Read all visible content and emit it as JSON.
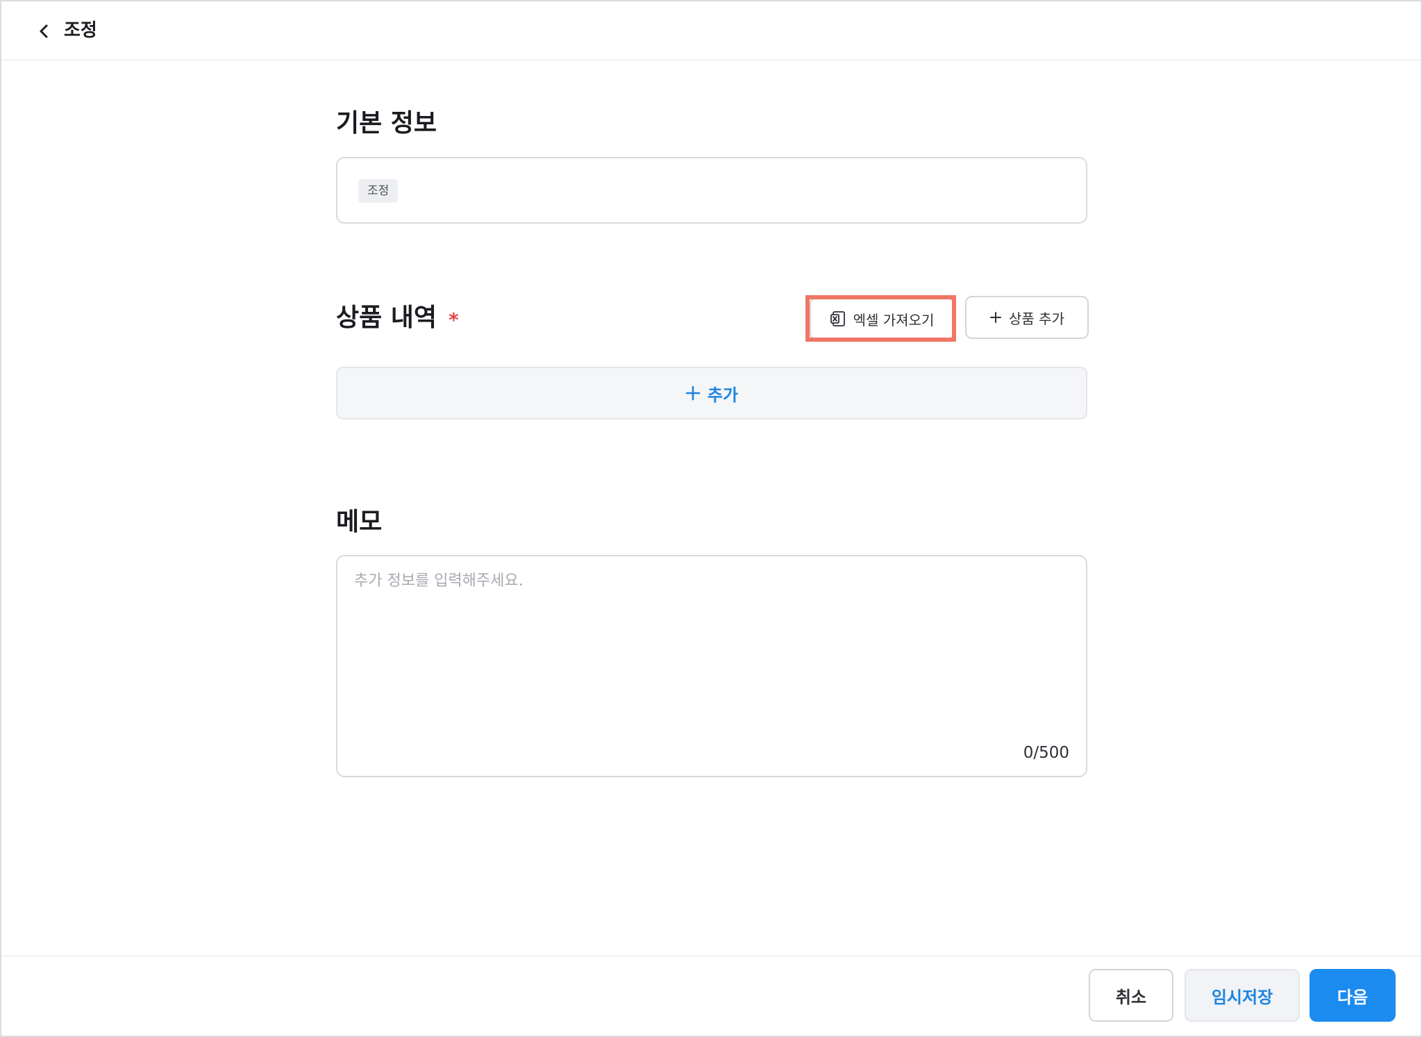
{
  "header": {
    "title": "조정",
    "back_icon": "chevron-left-icon"
  },
  "basic_info": {
    "title": "기본 정보",
    "tag": "조정"
  },
  "products": {
    "title": "상품 내역",
    "required_mark": "*",
    "excel_import_label": "엑셀 가져오기",
    "add_product_label": "상품 추가",
    "add_row_label": "추가"
  },
  "memo": {
    "title": "메모",
    "placeholder": "추가 정보를 입력해주세요.",
    "value": "",
    "counter": "0/500"
  },
  "footer": {
    "cancel_label": "취소",
    "draft_label": "임시저장",
    "next_label": "다음"
  },
  "colors": {
    "accent": "#1b8bf0",
    "accent_text": "#1b84e0",
    "required": "#e5484d",
    "highlight": "#f07666"
  }
}
